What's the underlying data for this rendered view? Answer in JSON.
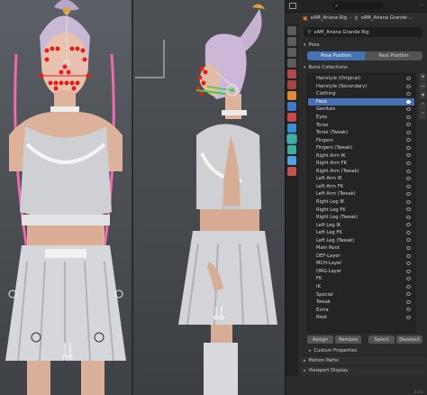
{
  "header": {
    "object_name": "xAM_Ariana Rig",
    "armature_name": "xAM_Ariana Grande ...",
    "data_field": "xAM_Ariana Grande Rig"
  },
  "pose": {
    "section_label": "Pose",
    "pose_position_label": "Pose Position",
    "rest_position_label": "Rest Position"
  },
  "bone_collections": {
    "section_label": "Bone Collections",
    "items": [
      "Hairstyle (Original)",
      "Hairstyle (Secondary)",
      "Clothing",
      "Face",
      "Genitals",
      "Eyes",
      "Torso",
      "Torso (Tweak)",
      "Fingers",
      "Fingers (Tweak)",
      "Right Arm IK",
      "Right Arm FK",
      "Right Arm (Tweak)",
      "Left Arm IK",
      "Left Arm FK",
      "Left Arm (Tweak)",
      "Right Leg IK",
      "Right Leg FK",
      "Right Leg (Tweak)",
      "Left Leg IK",
      "Left Leg FK",
      "Left Leg (Tweak)",
      "Main Root",
      "DEF-Layer",
      "MCH-Layer",
      "ORG-Layer",
      "FK",
      "IK",
      "Special",
      "Tweak",
      "Extra",
      "Root"
    ],
    "selected": "Face",
    "assign_label": "Assign",
    "remove_label": "Remove",
    "select_label": "Select",
    "deselect_label": "Deselect",
    "custom_properties_label": "Custom Properties"
  },
  "sections": {
    "motion_paths": "Motion Paths",
    "viewport_display": "Viewport Display"
  },
  "version": "4.0.1",
  "colors": {
    "accent": "#4772b3",
    "panel_bg": "#2b2b2b",
    "bone_red": "#e02020",
    "bone_green": "#3ad13a"
  }
}
